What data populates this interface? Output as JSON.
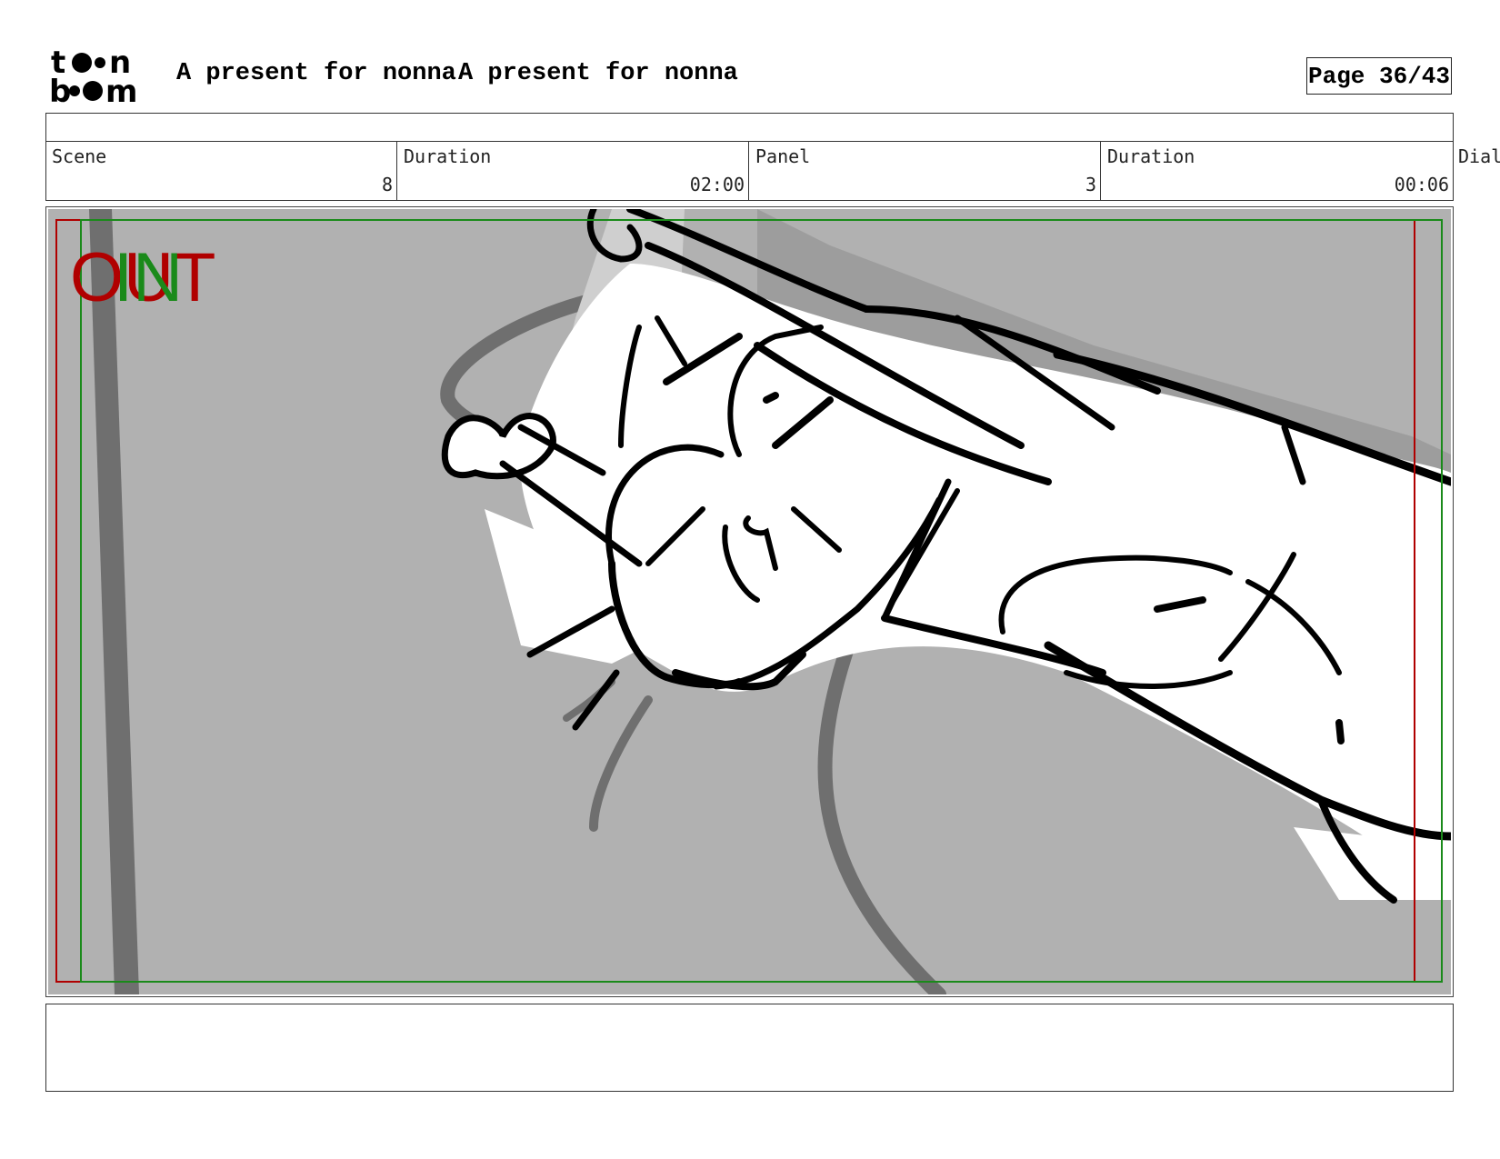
{
  "header": {
    "logo_top": "t••n",
    "logo_bottom": "b••m",
    "project_title": "A present for nonna",
    "episode_title": "A present for nonna",
    "page_label": "Page 36/43"
  },
  "info": {
    "scene_label": "Scene",
    "scene_value": "8",
    "scene_duration_label": "Duration",
    "scene_duration_value": "02:00",
    "panel_label": "Panel",
    "panel_value": "3",
    "panel_duration_label": "Duration",
    "panel_duration_value": "00:06",
    "dialog_label": "Dial"
  },
  "panel": {
    "out_label": "OUT",
    "in_label": "IN",
    "colors": {
      "background": "#b1b1b1",
      "out_frame": "#b00000",
      "in_frame": "#1a8a1a",
      "ink": "#000000",
      "shadow": "#6f6f6f"
    }
  }
}
